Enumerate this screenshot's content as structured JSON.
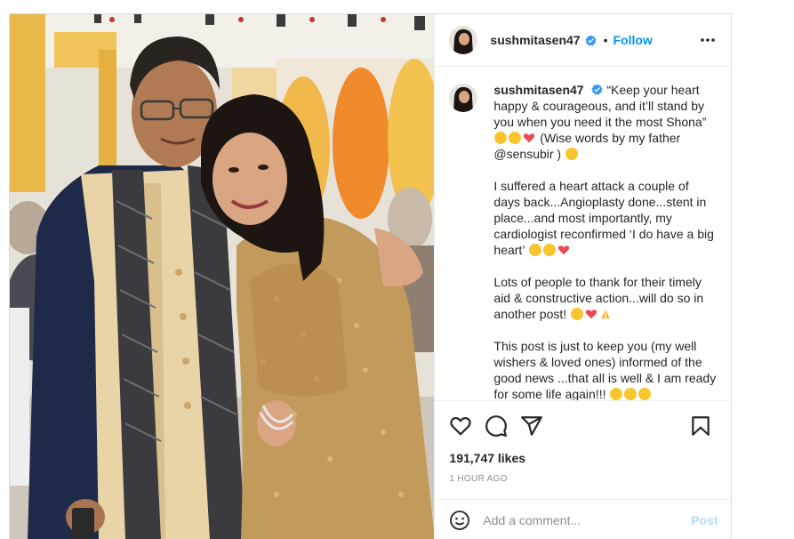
{
  "post": {
    "username": "sushmitasen47",
    "header_separator": "•",
    "follow_label": "Follow",
    "caption": {
      "username": "sushmitasen47",
      "p1_a": "“Keep your heart happy & courageous, and it’ll stand by you when you need it the most Shona”",
      "p1_b": "(Wise words by my father @sensubir )",
      "p2": "I suffered a heart attack a couple of days back...Angioplasty done...stent in place...and most importantly, my cardiologist reconfirmed ‘I do have a big heart’",
      "p3": "Lots of people to thank for their timely aid & constructive action...will do so in another post!",
      "p4": "This post is just to keep you (my well wishers & loved ones) informed of the good news ...that all is well & I am ready for some life again!!!"
    },
    "likes": "191,747 likes",
    "timestamp": "1 HOUR AGO",
    "comment_placeholder": "Add a comment...",
    "post_label": "Post"
  },
  "colors": {
    "accent": "#0095f6",
    "post_disabled": "#b3dbff",
    "verified": "#3897f0",
    "heart_red": "#ed4956",
    "muted": "#8e8e8e"
  },
  "icons": [
    "verified-badge-icon",
    "more-options-icon",
    "like-heart-icon",
    "comment-icon",
    "share-icon",
    "save-bookmark-icon",
    "emoji-icon"
  ]
}
